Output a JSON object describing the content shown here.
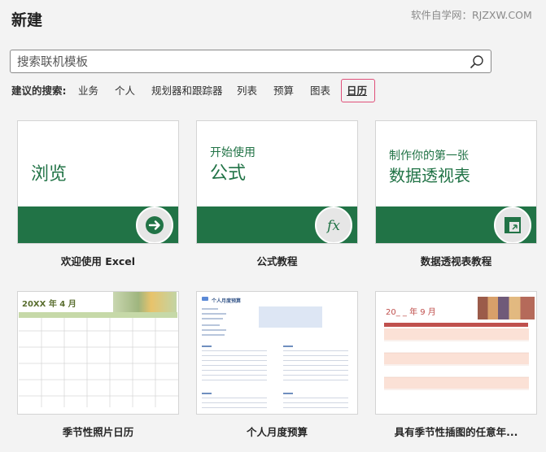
{
  "header": {
    "title": "新建",
    "watermark": "软件自学网：RJZXW.COM"
  },
  "search": {
    "placeholder": "搜索联机模板"
  },
  "suggested": {
    "label": "建议的搜索:",
    "items": [
      "业务",
      "个人",
      "规划器和跟踪器",
      "列表",
      "预算",
      "图表",
      "日历"
    ],
    "active": "日历"
  },
  "featured": [
    {
      "caption_small": "",
      "caption_big": "浏览",
      "icon": "arrow-right-icon",
      "label": "欢迎使用 Excel"
    },
    {
      "caption_small": "开始使用",
      "caption_big": "公式",
      "icon": "fx-icon",
      "label": "公式教程"
    },
    {
      "caption_small": "制作你的第一张",
      "caption_big": "数据透视表",
      "icon": "pivot-table-icon",
      "label": "数据透视表教程"
    }
  ],
  "templates": [
    {
      "heading": "20XX 年 4 月",
      "label": "季节性照片日历"
    },
    {
      "heading": "个人月度预算",
      "label": "个人月度预算"
    },
    {
      "heading": "20_ _ 年 9 月",
      "label": "具有季节性插图的任意年..."
    }
  ],
  "colors": {
    "accent_green": "#217346",
    "highlight_border": "#e0507a",
    "calendar_red": "#c0504d",
    "calendar_peach": "#fbe1d6"
  }
}
